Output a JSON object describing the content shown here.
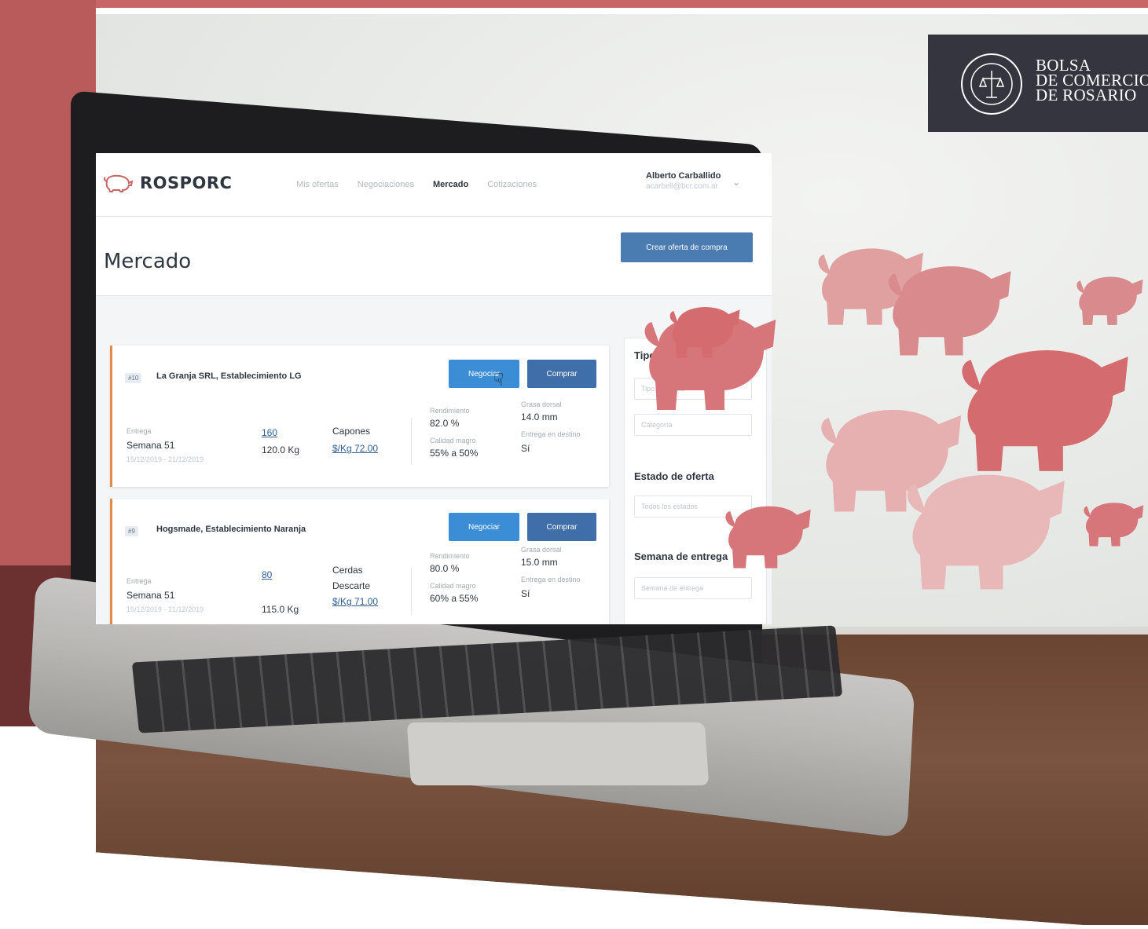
{
  "brand": {
    "logo_lines": [
      "BOLSA",
      "DE COMERCIO",
      "DE ROSARIO"
    ],
    "seal_text": "BOLSA DE COMERCIO DE ROSARIO"
  },
  "app": {
    "name": "ROSPORC",
    "nav": [
      "Mis ofertas",
      "Negociaciones",
      "Mercado",
      "Cotizaciones"
    ],
    "active_nav": "Mercado",
    "user_name": "Alberto Carballido",
    "user_email": "acarbell@bcr.com.ar",
    "page_title": "Mercado",
    "create_button": "Crear oferta de compra"
  },
  "offers": [
    {
      "id": "#10",
      "establishment": "La Granja SRL, Establecimiento LG",
      "negotiate_label": "Negociar",
      "buy_label": "Comprar",
      "delivery_label": "Entrega",
      "delivery_week": "Semana 51",
      "delivery_range": "15/12/2019 - 21/12/2019",
      "heads": "160",
      "weight": "120.0 Kg",
      "category_lines": [
        "Capones"
      ],
      "price": "$/Kg 72.00",
      "yield_label": "Rendimiento",
      "yield_value": "82.0 %",
      "lean_label": "Calidad magro",
      "lean_value": "55% a 50%",
      "fat_label": "Grasa dorsal",
      "fat_value": "14.0 mm",
      "dest_label": "Entrega en destino",
      "dest_value": "Sí"
    },
    {
      "id": "#9",
      "establishment": "Hogsmade, Establecimiento Naranja",
      "negotiate_label": "Negociar",
      "buy_label": "Comprar",
      "delivery_label": "Entrega",
      "delivery_week": "Semana 51",
      "delivery_range": "15/12/2019 - 21/12/2019",
      "heads": "80",
      "weight": "115.0 Kg",
      "category_lines": [
        "Cerdas",
        "Descarte"
      ],
      "price": "$/Kg 71.00",
      "yield_label": "Rendimiento",
      "yield_value": "80.0 %",
      "lean_label": "Calidad magro",
      "lean_value": "60% a 55%",
      "fat_label": "Grasa dorsal",
      "fat_value": "15.0 mm",
      "dest_label": "Entrega en destino",
      "dest_value": "Sí"
    }
  ],
  "filters": {
    "offer_type_title": "Tipo de oferta",
    "offer_type_placeholder": "Tipo de oferta",
    "category_placeholder": "Categoría",
    "offer_state_title": "Estado de oferta",
    "offer_state_value": "Todos los estados",
    "delivery_week_title": "Semana de entrega",
    "delivery_week_placeholder": "Semana de entrega"
  },
  "colors": {
    "accent_red": "#c86566",
    "pig_color": "#d7767a",
    "primary_blue": "#3b8ed6",
    "dark_blue": "#3f6ea8",
    "logo_bg": "#34353f"
  }
}
